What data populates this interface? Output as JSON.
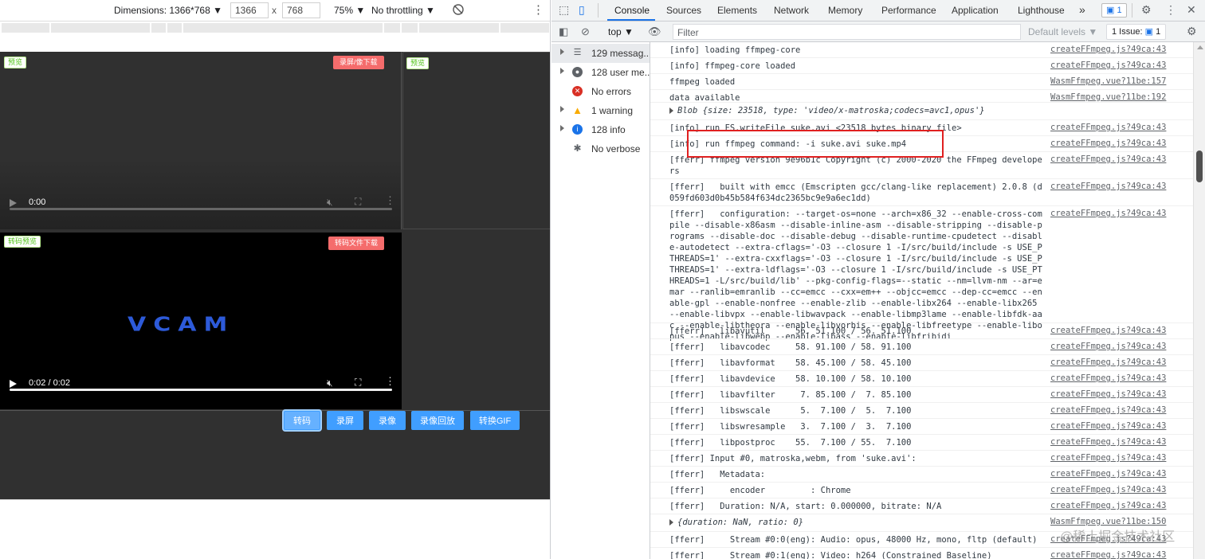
{
  "device_toolbar": {
    "dimensions_label": "Dimensions: 1366*768",
    "width_value": "1366",
    "height_value": "768",
    "times": "x",
    "zoom": "75%",
    "throttling": "No throttling",
    "more": "⋮"
  },
  "viewport": {
    "preview_tag": "预览",
    "preview_tag_2": "预览",
    "record_download": "录屏/像下载",
    "transcode_preview_tag": "转码预览",
    "transcode_download": "转码文件下载",
    "video1": {
      "time": "0:00",
      "progress": 0.0
    },
    "video2": {
      "time": "0:02 / 0:02",
      "progress": 1.0,
      "logo_text": "VCAM"
    },
    "buttons": [
      "转码",
      "录屏",
      "录像",
      "录像回放",
      "转换GIF"
    ]
  },
  "devtools": {
    "tabs": [
      "Console",
      "Sources",
      "Elements",
      "Network",
      "Memory",
      "Performance",
      "Application",
      "Lighthouse"
    ],
    "more_tabs": "»",
    "message_badge": "1",
    "context": "top",
    "filter_placeholder": "Filter",
    "default_levels": "Default levels ▼",
    "issues": "1 Issue:",
    "issues_count": "1",
    "sidebar": [
      {
        "label": "129 messag...",
        "icon": "list-icon"
      },
      {
        "label": "128 user me...",
        "icon": "user-icon"
      },
      {
        "label": "No errors",
        "icon": "error-icon"
      },
      {
        "label": "1 warning",
        "icon": "warning-icon"
      },
      {
        "label": "128 info",
        "icon": "info-icon"
      },
      {
        "label": "No verbose",
        "icon": "bug-icon"
      }
    ],
    "logs": [
      {
        "msg": "[info] loading ffmpeg-core",
        "src": "createFFmpeg.js?49ca:43"
      },
      {
        "msg": "[info] ffmpeg-core loaded",
        "src": "createFFmpeg.js?49ca:43"
      },
      {
        "msg": "ffmpeg loaded",
        "src": "WasmFfmpeg.vue?11be:157"
      },
      {
        "msg": "data available",
        "src": "WasmFfmpeg.vue?11be:192"
      },
      {
        "msg": "Blob {size: 23518, type: 'video/x-matroska;codecs=avc1,opus'}",
        "src": ""
      },
      {
        "msg": "[info] run FS.writeFile suke.avi <23518 bytes binary file>",
        "src": "createFFmpeg.js?49ca:43"
      },
      {
        "msg": "[info] run ffmpeg command: -i suke.avi suke.mp4",
        "src": "createFFmpeg.js?49ca:43"
      },
      {
        "msg": "[fferr] ffmpeg version 9e96b1c Copyright (c) 2000-2020 the FFmpeg developers",
        "src": "createFFmpeg.js?49ca:43"
      },
      {
        "msg": "[fferr]   built with emcc (Emscripten gcc/clang-like replacement) 2.0.8 (d059fd603d0b45b584f634dc2365bc9e9a6ec1dd)",
        "src": "createFFmpeg.js?49ca:43"
      },
      {
        "msg": "[fferr]   configuration: --target-os=none --arch=x86_32 --enable-cross-compile --disable-x86asm --disable-inline-asm --disable-stripping --disable-programs --disable-doc --disable-debug --disable-runtime-cpudetect --disable-autodetect --extra-cflags='-O3 --closure 1 -I/src/build/include -s USE_PTHREADS=1' --extra-cxxflags='-O3 --closure 1 -I/src/build/include -s USE_PTHREADS=1' --extra-ldflags='-O3 --closure 1 -I/src/build/include -s USE_PTHREADS=1 -L/src/build/lib' --pkg-config-flags=--static --nm=llvm-nm --ar=emar --ranlib=emranlib --cc=emcc --cxx=em++ --objcc=emcc --dep-cc=emcc --enable-gpl --enable-nonfree --enable-zlib --enable-libx264 --enable-libx265 --enable-libvpx --enable-libwavpack --enable-libmp3lame --enable-libfdk-aac --enable-libtheora --enable-libvorbis --enable-libfreetype --enable-libopus --enable-libwebp --enable-libass --enable-libfribidi",
        "src": "createFFmpeg.js?49ca:43"
      },
      {
        "msg": "[fferr]   libavutil      56. 51.100 / 56. 51.100",
        "src": "createFFmpeg.js?49ca:43"
      },
      {
        "msg": "[fferr]   libavcodec     58. 91.100 / 58. 91.100",
        "src": "createFFmpeg.js?49ca:43"
      },
      {
        "msg": "[fferr]   libavformat    58. 45.100 / 58. 45.100",
        "src": "createFFmpeg.js?49ca:43"
      },
      {
        "msg": "[fferr]   libavdevice    58. 10.100 / 58. 10.100",
        "src": "createFFmpeg.js?49ca:43"
      },
      {
        "msg": "[fferr]   libavfilter     7. 85.100 /  7. 85.100",
        "src": "createFFmpeg.js?49ca:43"
      },
      {
        "msg": "[fferr]   libswscale      5.  7.100 /  5.  7.100",
        "src": "createFFmpeg.js?49ca:43"
      },
      {
        "msg": "[fferr]   libswresample   3.  7.100 /  3.  7.100",
        "src": "createFFmpeg.js?49ca:43"
      },
      {
        "msg": "[fferr]   libpostproc    55.  7.100 / 55.  7.100",
        "src": "createFFmpeg.js?49ca:43"
      },
      {
        "msg": "[fferr] Input #0, matroska,webm, from 'suke.avi':",
        "src": "createFFmpeg.js?49ca:43"
      },
      {
        "msg": "[fferr]   Metadata:",
        "src": "createFFmpeg.js?49ca:43"
      },
      {
        "msg": "[fferr]     encoder         : Chrome",
        "src": "createFFmpeg.js?49ca:43"
      },
      {
        "msg": "[fferr]   Duration: N/A, start: 0.000000, bitrate: N/A",
        "src": "createFFmpeg.js?49ca:43"
      },
      {
        "msg": "{duration: NaN, ratio: 0}",
        "src": "WasmFfmpeg.vue?11be:150"
      },
      {
        "msg": "[fferr]     Stream #0:0(eng): Audio: opus, 48000 Hz, mono, fltp (default)",
        "src": "createFFmpeg.js?49ca:43"
      },
      {
        "msg": "[fferr]     Stream #0:1(eng): Video: h264 (Constrained Baseline)",
        "src": "createFFmpeg.js?49ca:43"
      }
    ]
  },
  "watermark": "@稀土掘金技术社区",
  "colors": {
    "accent": "#1a73e8",
    "button": "#409eff",
    "danger": "#f56c6c",
    "highlight": "#e02020"
  }
}
